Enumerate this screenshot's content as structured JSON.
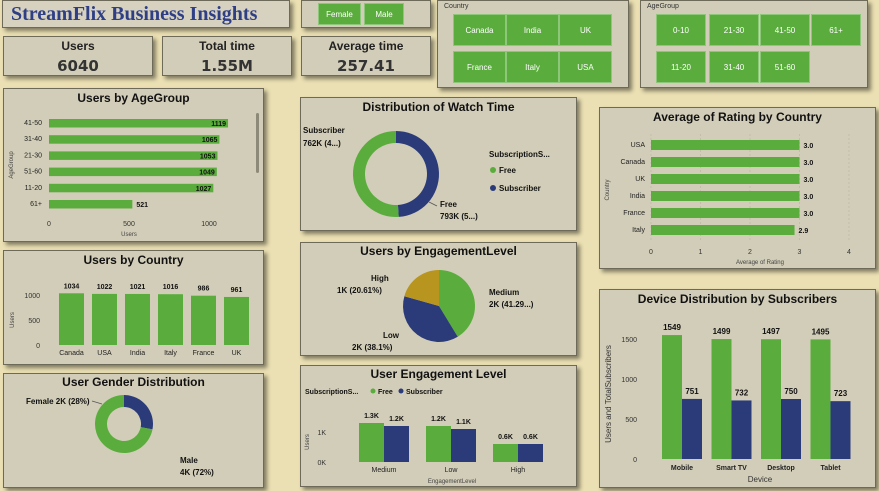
{
  "header": {
    "title": "StreamFlix Business Insights"
  },
  "gender_slicer": {
    "options": [
      "Female",
      "Male"
    ]
  },
  "country_slicer": {
    "caption": "Country",
    "options": [
      "Canada",
      "India",
      "UK",
      "France",
      "Italy",
      "USA"
    ]
  },
  "age_slicer": {
    "caption": "AgeGroup",
    "options": [
      "0-10",
      "21-30",
      "41-50",
      "61+",
      "11-20",
      "31-40",
      "51-60"
    ]
  },
  "kpis": [
    {
      "label": "Users",
      "value": "6040"
    },
    {
      "label": "Total time",
      "value": "1.55M"
    },
    {
      "label": "Average time",
      "value": "257.41"
    }
  ],
  "colors": {
    "green": "#5aad3c",
    "navy": "#2b3b7a",
    "gold": "#b8951e"
  },
  "chart_data": [
    {
      "id": "age",
      "type": "bar",
      "orientation": "horizontal",
      "title": "Users by AgeGroup",
      "xlabel": "Users",
      "ylabel": "AgeGroup",
      "categories": [
        "41-50",
        "31-40",
        "21-30",
        "51-60",
        "11-20",
        "61+"
      ],
      "values": [
        1119,
        1065,
        1053,
        1049,
        1027,
        521
      ],
      "data_labels": [
        "1119",
        "1065",
        "1053",
        "1049",
        "1027",
        "521"
      ],
      "xlim": [
        0,
        1000
      ],
      "ticks": [
        "0",
        "500",
        "1000"
      ]
    },
    {
      "id": "country",
      "type": "bar",
      "title": "Users by Country",
      "ylabel": "Users",
      "categories": [
        "Canada",
        "USA",
        "India",
        "Italy",
        "France",
        "UK"
      ],
      "values": [
        1034,
        1022,
        1021,
        1016,
        986,
        961
      ],
      "data_labels": [
        "1034",
        "1022",
        "1021",
        "1016",
        "986",
        "961"
      ],
      "ylim": [
        0,
        1000
      ],
      "ticks": [
        "0",
        "500",
        "1000"
      ]
    },
    {
      "id": "gender",
      "type": "pie",
      "donut": true,
      "title": "User Gender Distribution",
      "categories": [
        "Female",
        "Male"
      ],
      "values": [
        28,
        72
      ],
      "labels": [
        "Female 2K (28%)",
        "Male",
        "4K (72%)"
      ]
    },
    {
      "id": "watch",
      "type": "pie",
      "donut": true,
      "title": "Distribution of Watch Time",
      "categories": [
        "Subscriber",
        "Free"
      ],
      "values": [
        762,
        793
      ],
      "labels": [
        "Subscriber",
        "762K (4...)",
        "Free",
        "793K (5...)"
      ],
      "legend_title": "SubscriptionS...",
      "legend": [
        "Free",
        "Subscriber"
      ]
    },
    {
      "id": "engagement",
      "type": "pie",
      "title": "Users by EngagementLevel",
      "categories": [
        "Medium",
        "Low",
        "High"
      ],
      "values": [
        41.29,
        38.1,
        20.61
      ],
      "labels": [
        "High",
        "1K (20.61%)",
        "Medium",
        "2K (41.29...)",
        "Low",
        "2K (38.1%)"
      ]
    },
    {
      "id": "engage_level",
      "type": "bar",
      "title": "User Engagement Level",
      "xlabel": "EngagementLevel",
      "ylabel": "Users",
      "legend_title": "SubscriptionS...",
      "categories": [
        "Medium",
        "Low",
        "High"
      ],
      "series": [
        {
          "name": "Free",
          "values": [
            1.3,
            1.2,
            0.6
          ],
          "data_labels": [
            "1.3K",
            "1.2K",
            "0.6K"
          ]
        },
        {
          "name": "Subscriber",
          "values": [
            1.2,
            1.1,
            0.6
          ],
          "data_labels": [
            "1.2K",
            "1.1K",
            "0.6K"
          ]
        }
      ],
      "ylim": [
        0,
        1.5
      ],
      "ticks": [
        "0K",
        "1K"
      ]
    },
    {
      "id": "rating",
      "type": "bar",
      "orientation": "horizontal",
      "title": "Average of Rating by Country",
      "xlabel": "Average of Rating",
      "ylabel": "Country",
      "categories": [
        "USA",
        "Canada",
        "UK",
        "India",
        "France",
        "Italy"
      ],
      "values": [
        3.0,
        3.0,
        3.0,
        3.0,
        3.0,
        2.9
      ],
      "data_labels": [
        "3.0",
        "3.0",
        "3.0",
        "3.0",
        "3.0",
        "2.9"
      ],
      "xlim": [
        0,
        4
      ],
      "ticks": [
        "0",
        "1",
        "2",
        "3",
        "4"
      ]
    },
    {
      "id": "device",
      "type": "bar",
      "title": "Device Distribution by Subscribers",
      "xlabel": "Device",
      "ylabel": "Users and TotalSubscribers",
      "categories": [
        "Mobile",
        "Smart TV",
        "Desktop",
        "Tablet"
      ],
      "series": [
        {
          "values": [
            1549,
            1499,
            1497,
            1495
          ],
          "data_labels": [
            "1549",
            "1499",
            "1497",
            "1495"
          ]
        },
        {
          "values": [
            751,
            732,
            750,
            723
          ],
          "data_labels": [
            "751",
            "732",
            "750",
            "723"
          ]
        }
      ],
      "ylim": [
        0,
        1600
      ],
      "ticks": [
        "0",
        "500",
        "1000",
        "1500"
      ]
    }
  ]
}
